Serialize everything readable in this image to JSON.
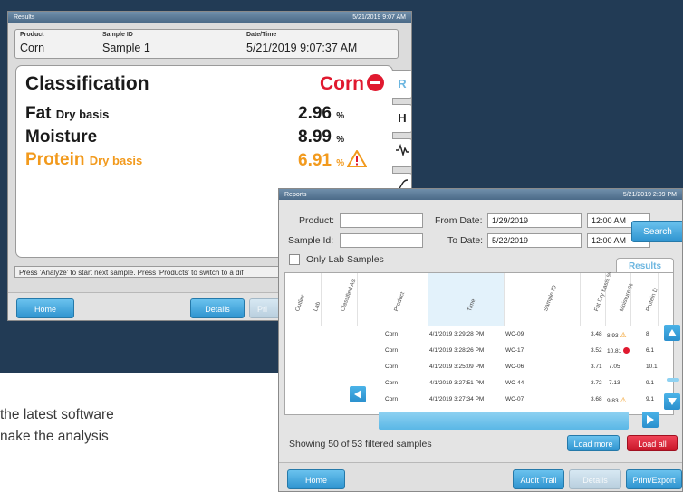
{
  "marketing": {
    "line1": "the latest software",
    "line2": "nake the analysis"
  },
  "results": {
    "title": "Results",
    "datetime": "5/21/2019 9:07 AM",
    "header": {
      "product_label": "Product",
      "product": "Corn",
      "sample_label": "Sample ID",
      "sample": "Sample 1",
      "date_label": "Date/Time",
      "date": "5/21/2019 9:07:37 AM"
    },
    "classification": {
      "label": "Classification",
      "value": "Corn"
    },
    "rows": [
      {
        "name": "Fat",
        "basis": "Dry basis",
        "value": "2.96",
        "unit": "%"
      },
      {
        "name": "Moisture",
        "basis": "",
        "value": "8.99",
        "unit": "%"
      },
      {
        "name": "Protein",
        "basis": "Dry basis",
        "value": "6.91",
        "unit": "%"
      }
    ],
    "side_tabs": [
      "R",
      "H"
    ],
    "status": "Press 'Analyze' to start next sample. Press 'Products' to switch to a dif",
    "buttons": {
      "home": "Home",
      "details": "Details",
      "print": "Pri"
    }
  },
  "reports": {
    "title": "Reports",
    "datetime": "5/21/2019 2:09 PM",
    "product_label": "Product:",
    "sample_label": "Sample Id:",
    "from_label": "From Date:",
    "from_date": "1/29/2019",
    "from_time": "12:00 AM",
    "to_label": "To Date:",
    "to_date": "5/22/2019",
    "to_time": "12:00 AM",
    "search": "Search",
    "lab_only": "Only Lab Samples",
    "results_tab": "Results",
    "columns": [
      "Outlier",
      "Lab",
      "Classified As",
      "Product",
      "Time",
      "Sample ID",
      "Fat Dry basis %",
      "Moisture %",
      "Protein D"
    ],
    "rows": [
      {
        "product": "Corn",
        "time": "4/1/2019 3:29:28 PM",
        "sample": "WC-09",
        "fat": "3.48",
        "moisture": "8.93",
        "protein": "8"
      },
      {
        "product": "Corn",
        "time": "4/1/2019 3:28:26 PM",
        "sample": "WC-17",
        "fat": "3.52",
        "moisture": "10.81",
        "protein": "6.1"
      },
      {
        "product": "Corn",
        "time": "4/1/2019 3:25:09 PM",
        "sample": "WC-06",
        "fat": "3.71",
        "moisture": "7.05",
        "protein": "10.1"
      },
      {
        "product": "Corn",
        "time": "4/1/2019 3:27:51 PM",
        "sample": "WC-44",
        "fat": "3.72",
        "moisture": "7.13",
        "protein": "9.1"
      },
      {
        "product": "Corn",
        "time": "4/1/2019 3:27:34 PM",
        "sample": "WC-07",
        "fat": "3.68",
        "moisture": "9.83",
        "protein": "9.1"
      }
    ],
    "showing": "Showing 50 of 53 filtered samples",
    "load_more": "Load more",
    "load_all": "Load all",
    "buttons": {
      "home": "Home",
      "audit": "Audit Trail",
      "details": "Details",
      "print_export": "Print/Export"
    }
  },
  "colors": {
    "accent_blue": "#2f94d0",
    "warning_orange": "#f29a1d",
    "stop_red": "#e0192f",
    "dark_bg": "#223b55"
  }
}
